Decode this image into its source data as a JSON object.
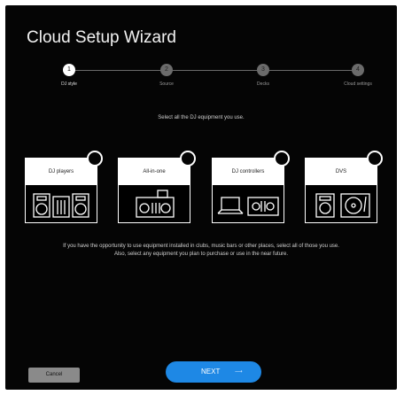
{
  "window": {
    "title": "Cloud Setup Wizard"
  },
  "steps": [
    {
      "number": "1",
      "label": "DJ style",
      "active": true
    },
    {
      "number": "2",
      "label": "Source",
      "active": false
    },
    {
      "number": "3",
      "label": "Decks",
      "active": false
    },
    {
      "number": "4",
      "label": "Cloud settings",
      "active": false
    }
  ],
  "instruction": "Select all the DJ equipment you use.",
  "cards": [
    {
      "label": "DJ players",
      "icon": "cdj-mixer-icon"
    },
    {
      "label": "All-in-one",
      "icon": "all-in-one-controller-icon"
    },
    {
      "label": "DJ controllers",
      "icon": "laptop-controller-icon"
    },
    {
      "label": "DVS",
      "icon": "turntable-icon"
    }
  ],
  "note": {
    "line1": "If you have the opportunity to use equipment installed in clubs, music bars or other places, select all of those you use.",
    "line2": "Also, select any equipment you plan to purchase or use in the near future."
  },
  "buttons": {
    "cancel": "Cancel",
    "next": "NEXT",
    "next_arrow": "⟶"
  },
  "colors": {
    "background": "#050505",
    "accent": "#1e88e5"
  }
}
